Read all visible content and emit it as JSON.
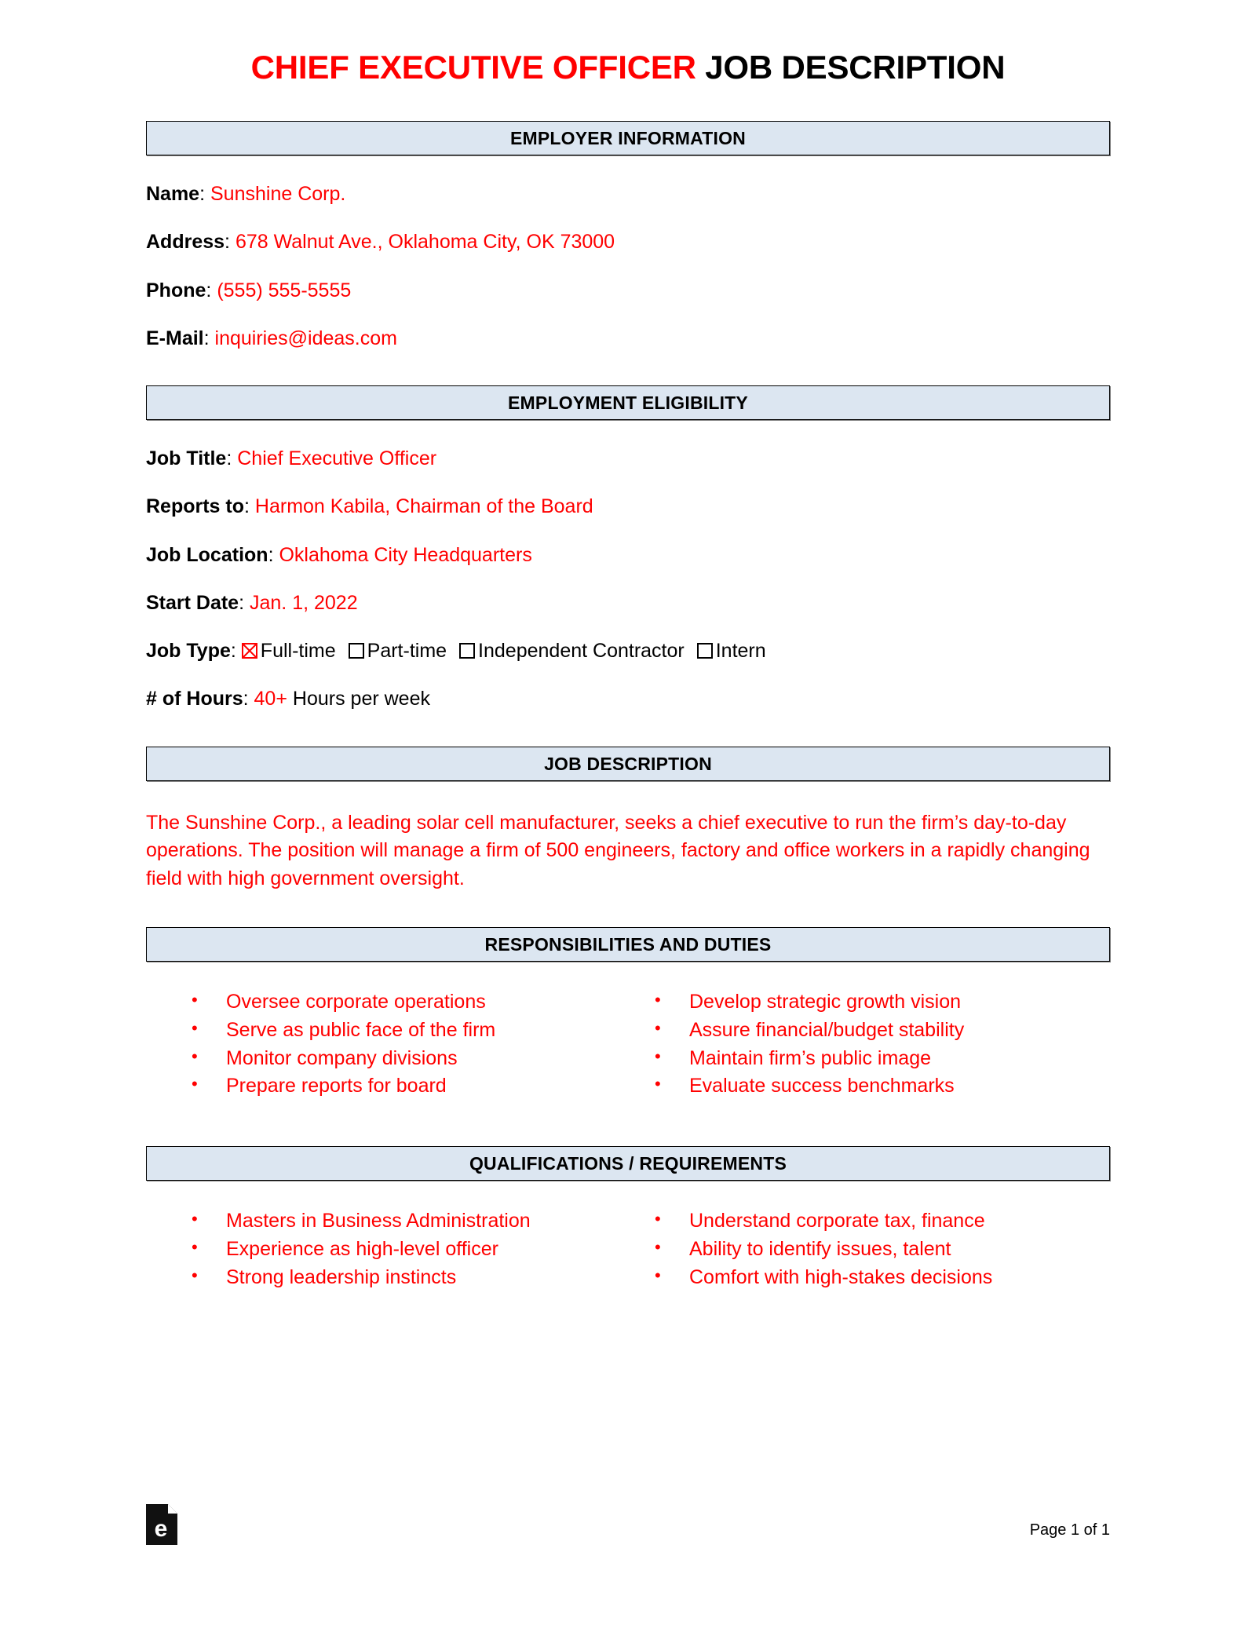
{
  "title": {
    "highlight": "CHIEF EXECUTIVE OFFICER",
    "rest": " JOB DESCRIPTION"
  },
  "sections": {
    "employer_information": "EMPLOYER INFORMATION",
    "employment_eligibility": "EMPLOYMENT ELIGIBILITY",
    "job_description": "JOB DESCRIPTION",
    "responsibilities": "RESPONSIBILITIES AND DUTIES",
    "qualifications": "QUALIFICATIONS / REQUIREMENTS"
  },
  "employer": {
    "name_label": "Name",
    "name_value": "Sunshine Corp.",
    "address_label": "Address",
    "address_value": "678 Walnut Ave., Oklahoma City, OK 73000",
    "phone_label": "Phone",
    "phone_value": "(555) 555-5555",
    "email_label": "E-Mail",
    "email_value": "inquiries@ideas.com"
  },
  "eligibility": {
    "job_title_label": "Job Title",
    "job_title_value": "Chief Executive Officer",
    "reports_to_label": "Reports to",
    "reports_to_value": "Harmon Kabila, Chairman of the Board",
    "job_location_label": "Job Location",
    "job_location_value": "Oklahoma City Headquarters",
    "start_date_label": "Start Date",
    "start_date_value": "Jan. 1, 2022",
    "job_type_label": "Job Type",
    "job_type_options": [
      {
        "label": "Full-time",
        "checked": true
      },
      {
        "label": "Part-time",
        "checked": false
      },
      {
        "label": "Independent Contractor",
        "checked": false
      },
      {
        "label": "Intern",
        "checked": false
      }
    ],
    "hours_label": "# of Hours",
    "hours_value": "40+",
    "hours_suffix": "Hours per week"
  },
  "description": {
    "text": "The Sunshine Corp., a leading solar cell manufacturer, seeks a chief executive to run the firm’s day-to-day operations. The position will manage a firm of 500 engineers, factory and office workers in a rapidly changing field with high government oversight."
  },
  "responsibilities": {
    "left": [
      "Oversee corporate operations",
      "Serve as public face of the firm",
      "Monitor company divisions",
      "Prepare reports for board"
    ],
    "right": [
      "Develop strategic growth vision",
      "Assure financial/budget stability",
      "Maintain firm’s public image",
      "Evaluate success benchmarks"
    ]
  },
  "qualifications": {
    "left": [
      "Masters in Business Administration",
      "Experience as high-level officer",
      "Strong leadership instincts"
    ],
    "right": [
      "Understand corporate tax, finance",
      "Ability to identify issues, talent",
      "Comfort with high-stakes decisions"
    ]
  },
  "footer": {
    "logo_letter": "e",
    "page_number": "Page 1 of 1"
  },
  "colors": {
    "accent_red": "#FF0000",
    "section_bg": "#DCE6F1",
    "border": "#000000"
  }
}
